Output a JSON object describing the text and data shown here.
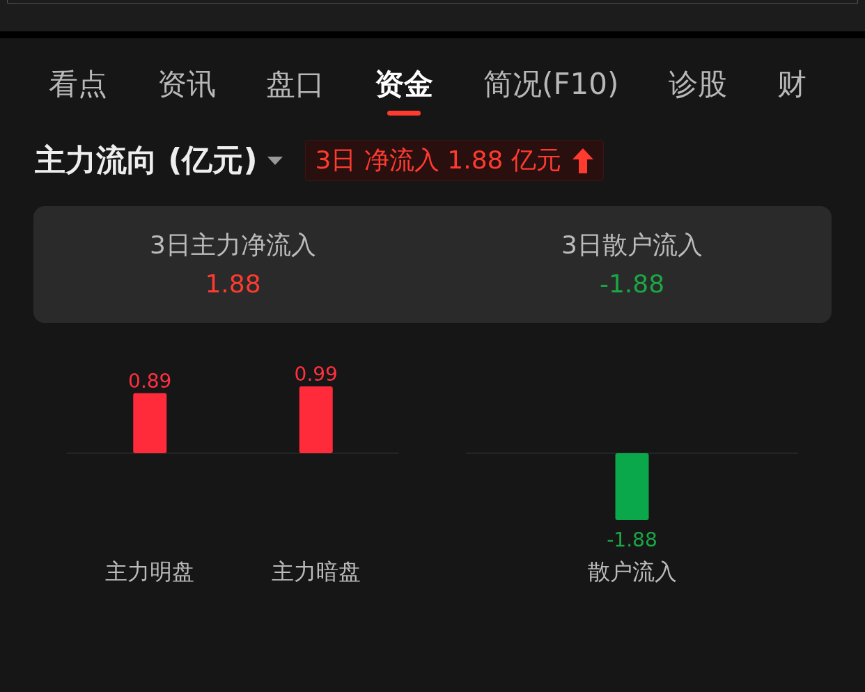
{
  "tabs": [
    {
      "label": "看点",
      "selected": false
    },
    {
      "label": "资讯",
      "selected": false
    },
    {
      "label": "盘口",
      "selected": false
    },
    {
      "label": "资金",
      "selected": true
    },
    {
      "label": "简况(F10)",
      "selected": false
    },
    {
      "label": "诊股",
      "selected": false
    },
    {
      "label": "财",
      "selected": false
    }
  ],
  "flow": {
    "title": "主力流向 (亿元)",
    "badge": "3日 净流入 1.88 亿元",
    "color": "#ff3b30"
  },
  "summary": [
    {
      "label": "3日主力净流入",
      "value": "1.88",
      "color": "#ff3b30"
    },
    {
      "label": "3日散户流入",
      "value": "-1.88",
      "color": "#1aa744"
    }
  ],
  "charts": [
    {
      "chart_data": {
        "type": "bar",
        "categories": [
          "主力明盘",
          "主力暗盘"
        ],
        "values": [
          0.89,
          0.99
        ],
        "data_labels": true
      }
    },
    {
      "chart_data": {
        "type": "bar",
        "categories": [
          "散户流入"
        ],
        "values": [
          -1.88
        ],
        "data_labels": true
      }
    }
  ]
}
